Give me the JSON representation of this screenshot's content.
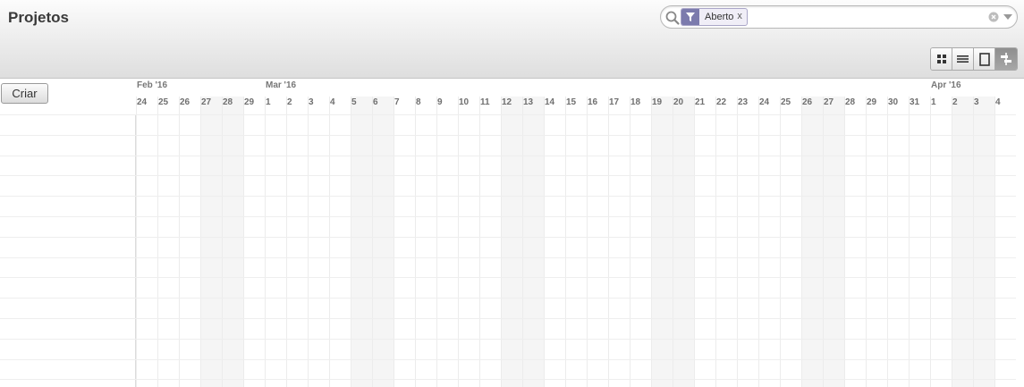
{
  "header": {
    "title": "Projetos"
  },
  "search": {
    "facet_value": "Aberto",
    "facet_remove": "x",
    "facet_color": "#7c7bad"
  },
  "view_switcher": {
    "views": [
      "kanban-icon",
      "list-icon",
      "form-icon",
      "gantt-icon"
    ],
    "active": "gantt-icon"
  },
  "actions": {
    "create_label": "Criar"
  },
  "gantt": {
    "months": [
      {
        "label": "Feb '16",
        "start_index": 0
      },
      {
        "label": "Mar '16",
        "start_index": 6
      },
      {
        "label": "Apr '16",
        "start_index": 37
      }
    ],
    "days": [
      "24",
      "25",
      "26",
      "27",
      "28",
      "29",
      "1",
      "2",
      "3",
      "4",
      "5",
      "6",
      "7",
      "8",
      "9",
      "10",
      "11",
      "12",
      "13",
      "14",
      "15",
      "16",
      "17",
      "18",
      "19",
      "20",
      "21",
      "22",
      "23",
      "24",
      "25",
      "26",
      "27",
      "28",
      "29",
      "30",
      "31",
      "1",
      "2",
      "3",
      "4"
    ],
    "weekend_days": [
      3,
      4,
      10,
      11,
      17,
      18,
      24,
      25,
      31,
      32,
      38,
      39
    ],
    "row_count": 14
  }
}
